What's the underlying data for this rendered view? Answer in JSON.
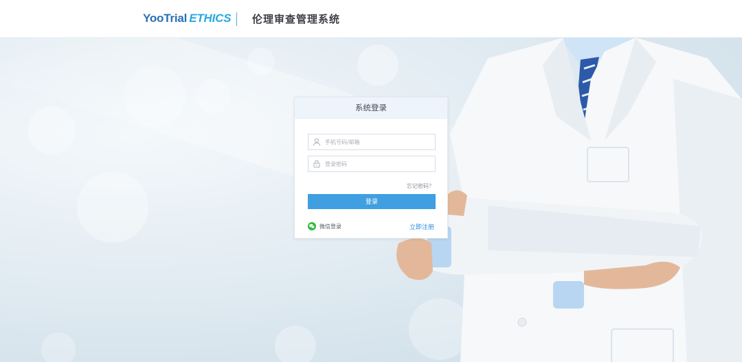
{
  "header": {
    "logo_yoo": "YooTrial",
    "logo_ethics": "ETHICS",
    "system_title": "伦理审查管理系统"
  },
  "login": {
    "title": "系统登录",
    "username_placeholder": "手机号码/邮箱",
    "password_placeholder": "登录密码",
    "forgot_label": "忘记密码？",
    "submit_label": "登录",
    "wechat_label": "微信登录",
    "register_label": "立即注册"
  },
  "colors": {
    "brand_dark_blue": "#2a6fb4",
    "brand_light_blue": "#27a9e1",
    "button_blue": "#3f9fe0",
    "wechat_green": "#2dbb3a",
    "link_blue": "#2f8fd8"
  },
  "icons": {
    "username": "user-icon",
    "password": "lock-icon",
    "wechat": "wechat-icon"
  }
}
